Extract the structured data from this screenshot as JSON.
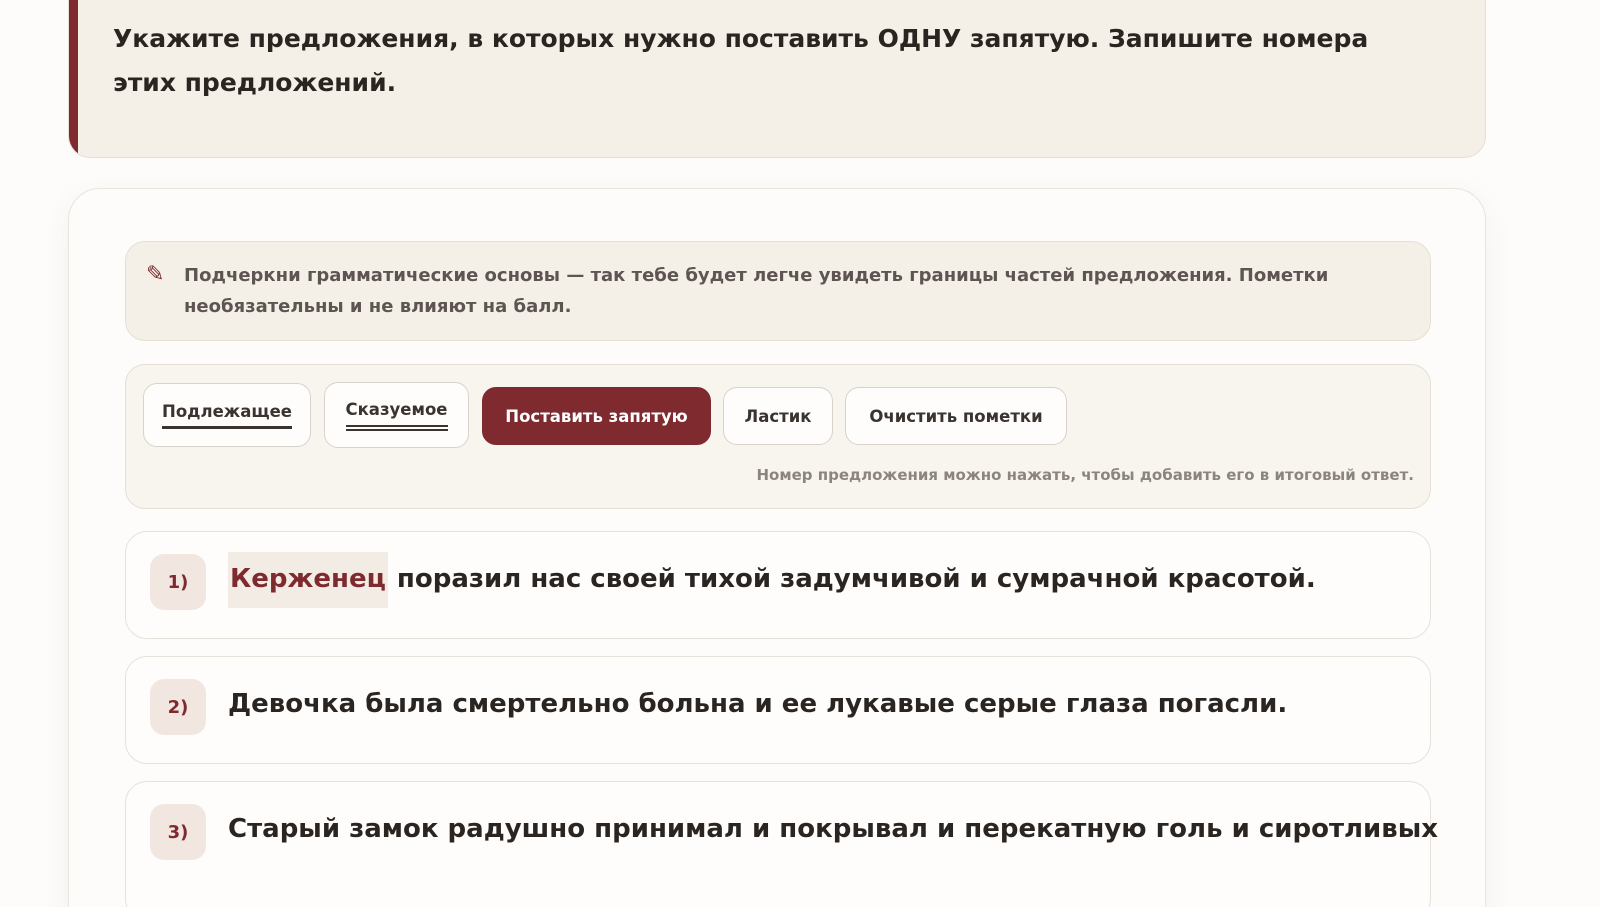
{
  "task": {
    "text": "Укажите предложения, в которых нужно поставить ОДНУ запятую. Запишите номера этих предложений."
  },
  "hint": {
    "icon": "pencil-icon",
    "text": "Подчеркни грамматические основы — так тебе будет легче увидеть границы частей предложения. Пометки необязательны и не влияют на балл."
  },
  "toolbar": {
    "subject_label": "Подлежащее",
    "predicate_label": "Сказуемое",
    "comma_label": "Поставить запятую",
    "eraser_label": "Ластик",
    "clear_label": "Очистить пометки",
    "note": "Номер предложения можно нажать, чтобы добавить его в итоговый ответ."
  },
  "sentences": [
    {
      "number": "1)",
      "marked_word": "Керженец",
      "rest": " поразил нас своей тихой задумчивой и сумрачной красотой."
    },
    {
      "number": "2)",
      "text": "Девочка была смертельно больна и ее лукавые серые глаза погасли."
    },
    {
      "number": "3)",
      "text": "Старый замок радушно принимал и покрывал и перекатную голь и сиротливых"
    }
  ],
  "colors": {
    "accent": "#7e2a2e",
    "card_bg": "#f4f0e8",
    "text": "#2b2522"
  }
}
